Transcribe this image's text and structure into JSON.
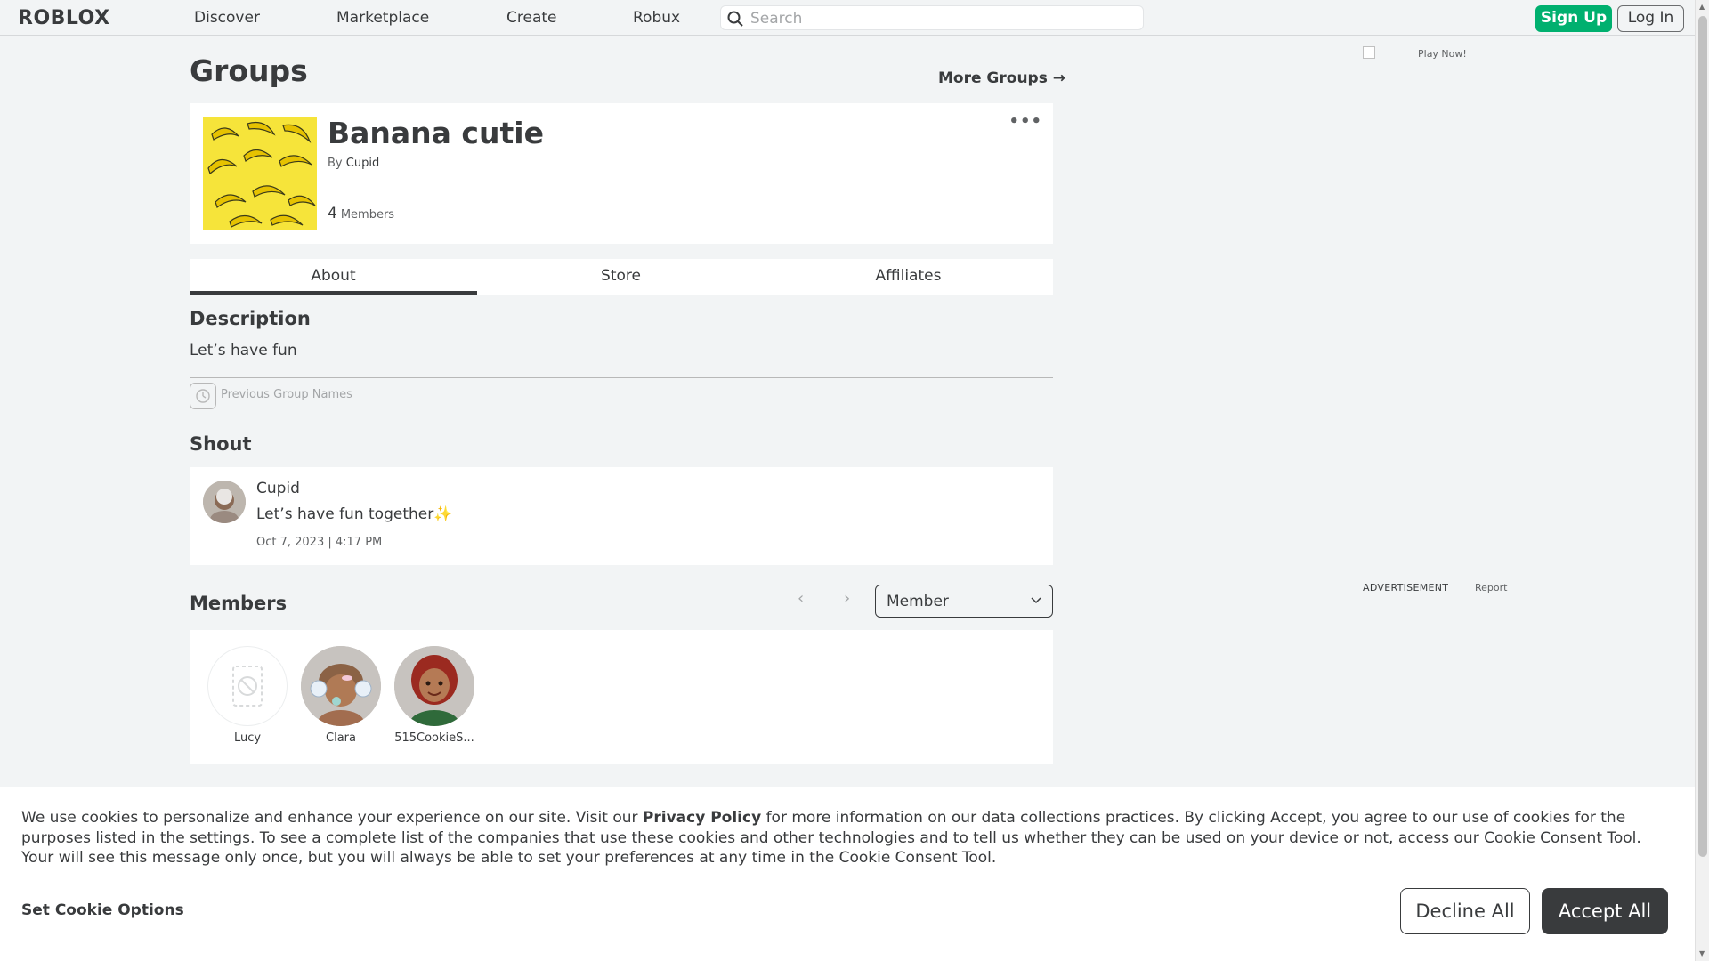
{
  "nav": {
    "logo": "ROBLOX",
    "links": [
      "Discover",
      "Marketplace",
      "Create",
      "Robux"
    ],
    "search_placeholder": "Search",
    "signup": "Sign Up",
    "login": "Log In"
  },
  "page": {
    "title": "Groups",
    "more_groups": "More Groups →"
  },
  "group": {
    "name": "Banana cutie",
    "by_label": "By",
    "owner": "Cupid",
    "member_count": "4",
    "member_label": "Members",
    "more_icon": "ellipsis-icon"
  },
  "tabs": [
    "About",
    "Store",
    "Affiliates"
  ],
  "description": {
    "title": "Description",
    "text": "Let’s have fun",
    "previous_names": "Previous Group Names"
  },
  "shout": {
    "title": "Shout",
    "author": "Cupid",
    "text": "Let’s have fun together✨",
    "date": "Oct 7, 2023 | 4:17 PM"
  },
  "members": {
    "title": "Members",
    "role_selected": "Member",
    "list": [
      {
        "name": "Lucy",
        "avatar": "placeholder-icon"
      },
      {
        "name": "Clara",
        "avatar": "avatar-image"
      },
      {
        "name": "515CookieS...",
        "avatar": "avatar-image"
      }
    ]
  },
  "ad": {
    "image_alt": "Play Now!",
    "label": "ADVERTISEMENT",
    "report": "Report"
  },
  "cookie": {
    "text_pre": "We use cookies to personalize and enhance your experience on our site. Visit our ",
    "privacy_link": "Privacy Policy",
    "text_post": " for more information on our data collections practices. By clicking Accept, you agree to our use of cookies for the purposes listed in the settings. To see a complete list of the companies that use these cookies and other technologies and to tell us whether they can be used on your device or not, access our Cookie Consent Tool. Your will see this message only once, but you will always be able to set your preferences at any time in the Cookie Consent Tool.",
    "set_options": "Set Cookie Options",
    "decline": "Decline All",
    "accept": "Accept All"
  },
  "colors": {
    "accent_green": "#00b06f",
    "text_dark": "#393b3d",
    "background": "#f2f4f5"
  }
}
